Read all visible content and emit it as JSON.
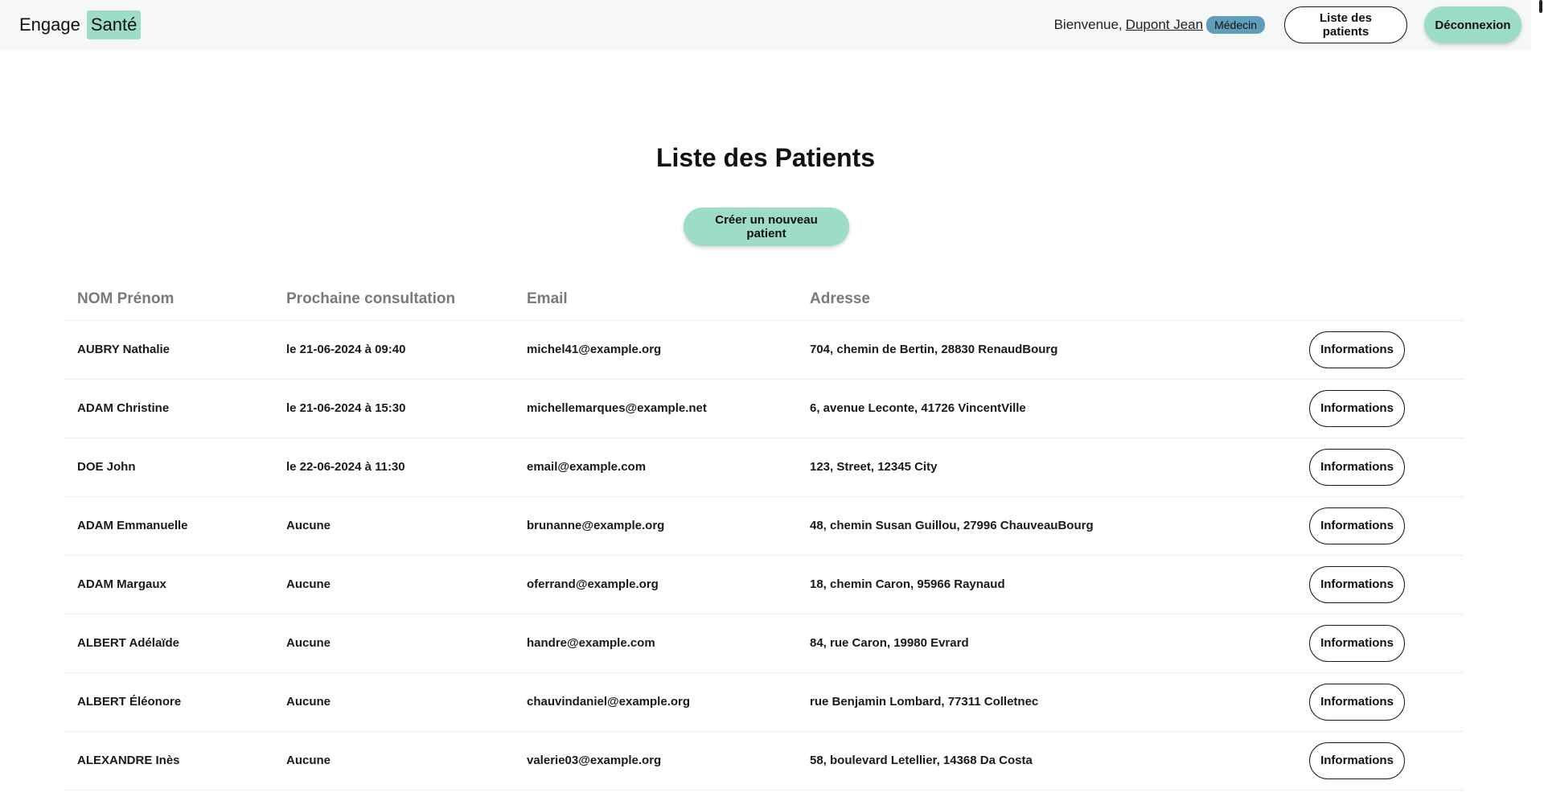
{
  "brand": {
    "word1": "Engage",
    "word2": "Santé"
  },
  "header": {
    "welcome_text": "Bienvenue,",
    "user_name": "Dupont Jean",
    "role": "Médecin",
    "patients_button": "Liste des patients",
    "logout_button": "Déconnexion"
  },
  "main": {
    "title": "Liste des Patients",
    "create_button": "Créer un nouveau patient"
  },
  "table": {
    "columns": [
      "NOM Prénom",
      "Prochaine consultation",
      "Email",
      "Adresse",
      ""
    ],
    "action_label": "Informations",
    "rows": [
      {
        "name": "AUBRY Nathalie",
        "next": "le 21-06-2024 à 09:40",
        "email": "michel41@example.org",
        "address": "704, chemin de Bertin, 28830 RenaudBourg"
      },
      {
        "name": "ADAM Christine",
        "next": "le 21-06-2024 à 15:30",
        "email": "michellemarques@example.net",
        "address": "6, avenue Leconte, 41726 VincentVille"
      },
      {
        "name": "DOE John",
        "next": "le 22-06-2024 à 11:30",
        "email": "email@example.com",
        "address": "123, Street, 12345 City"
      },
      {
        "name": "ADAM Emmanuelle",
        "next": "Aucune",
        "email": "brunanne@example.org",
        "address": "48, chemin Susan Guillou, 27996 ChauveauBourg"
      },
      {
        "name": "ADAM Margaux",
        "next": "Aucune",
        "email": "oferrand@example.org",
        "address": "18, chemin Caron, 95966 Raynaud"
      },
      {
        "name": "ALBERT Adélaïde",
        "next": "Aucune",
        "email": "handre@example.com",
        "address": "84, rue Caron, 19980 Evrard"
      },
      {
        "name": "ALBERT Éléonore",
        "next": "Aucune",
        "email": "chauvindaniel@example.org",
        "address": "rue Benjamin Lombard, 77311 Colletnec"
      },
      {
        "name": "ALEXANDRE Inès",
        "next": "Aucune",
        "email": "valerie03@example.org",
        "address": "58, boulevard Letellier, 14368 Da Costa"
      }
    ]
  },
  "colors": {
    "accent": "#9ddcc6",
    "badge": "#5f9dba",
    "navbar_bg": "#f6f7f8"
  }
}
